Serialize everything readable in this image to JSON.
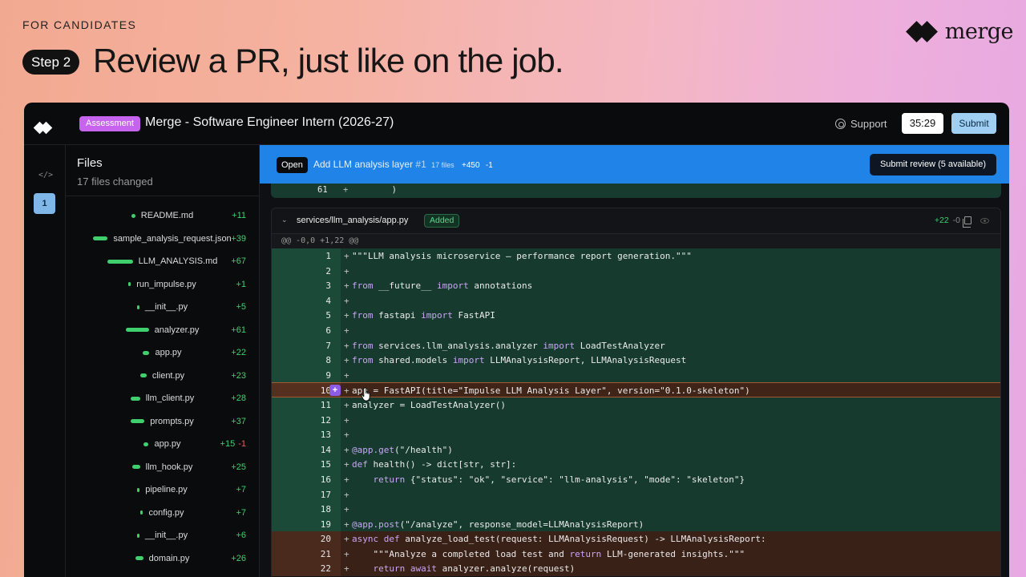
{
  "hero": {
    "eyebrow": "FOR CANDIDATES",
    "step_label": "Step 2",
    "title": "Review a PR, just like on the job."
  },
  "brand": {
    "name": "merge"
  },
  "header": {
    "badge": "Assessment",
    "title": "Merge - Software Engineer Intern (2026-27)",
    "support_label": "Support",
    "timer": "35:29",
    "submit_label": "Submit"
  },
  "rail": {
    "code_icon": "</>",
    "active_item": "1"
  },
  "files_panel": {
    "title": "Files",
    "subtitle": "17 files changed",
    "files": [
      {
        "name": "README.md",
        "added": "+11",
        "removed": "",
        "bar": 5
      },
      {
        "name": "sample_analysis_request.json",
        "added": "+39",
        "removed": "",
        "bar": 18
      },
      {
        "name": "LLM_ANALYSIS.md",
        "added": "+67",
        "removed": "",
        "bar": 32
      },
      {
        "name": "run_impulse.py",
        "added": "+1",
        "removed": "",
        "bar": 3
      },
      {
        "name": "__init__.py",
        "added": "+5",
        "removed": "",
        "bar": 3
      },
      {
        "name": "analyzer.py",
        "added": "+61",
        "removed": "",
        "bar": 29
      },
      {
        "name": "app.py",
        "added": "+22",
        "removed": "",
        "bar": 8
      },
      {
        "name": "client.py",
        "added": "+23",
        "removed": "",
        "bar": 8
      },
      {
        "name": "llm_client.py",
        "added": "+28",
        "removed": "",
        "bar": 12
      },
      {
        "name": "prompts.py",
        "added": "+37",
        "removed": "",
        "bar": 17
      },
      {
        "name": "app.py",
        "added": "+15",
        "removed": "-1",
        "bar": 6
      },
      {
        "name": "llm_hook.py",
        "added": "+25",
        "removed": "",
        "bar": 10
      },
      {
        "name": "pipeline.py",
        "added": "+7",
        "removed": "",
        "bar": 3
      },
      {
        "name": "config.py",
        "added": "+7",
        "removed": "",
        "bar": 3
      },
      {
        "name": "__init__.py",
        "added": "+6",
        "removed": "",
        "bar": 3
      },
      {
        "name": "domain.py",
        "added": "+26",
        "removed": "",
        "bar": 10
      }
    ]
  },
  "pr": {
    "status": "Open",
    "title": "Add LLM analysis layer",
    "number": "#1",
    "files_count": "17 files",
    "additions": "+450",
    "deletions": "-1",
    "review_button": "Submit review (5 available)"
  },
  "previous_hunk": {
    "line": "61",
    "sign": "+",
    "code": "        )"
  },
  "file_card": {
    "path": "services/llm_analysis/app.py",
    "status": "Added",
    "additions": "+22",
    "deletions": "-0",
    "hunk_header": "@@ -0,0 +1,22 @@",
    "add_comment_label": "+",
    "lines": [
      {
        "n": "1",
        "code": "\"\"\"LLM analysis microservice — performance report generation.\"\"\""
      },
      {
        "n": "2",
        "code": ""
      },
      {
        "n": "3",
        "code": "from __future__ import annotations"
      },
      {
        "n": "4",
        "code": ""
      },
      {
        "n": "5",
        "code": "from fastapi import FastAPI"
      },
      {
        "n": "6",
        "code": ""
      },
      {
        "n": "7",
        "code": "from services.llm_analysis.analyzer import LoadTestAnalyzer"
      },
      {
        "n": "8",
        "code": "from shared.models import LLMAnalysisReport, LLMAnalysisRequest"
      },
      {
        "n": "9",
        "code": ""
      },
      {
        "n": "10",
        "code": "app = FastAPI(title=\"Impulse LLM Analysis Layer\", version=\"0.1.0-skeleton\")"
      },
      {
        "n": "11",
        "code": "analyzer = LoadTestAnalyzer()"
      },
      {
        "n": "12",
        "code": ""
      },
      {
        "n": "13",
        "code": ""
      },
      {
        "n": "14",
        "code": "@app.get(\"/health\")"
      },
      {
        "n": "15",
        "code": "def health() -> dict[str, str]:"
      },
      {
        "n": "16",
        "code": "    return {\"status\": \"ok\", \"service\": \"llm-analysis\", \"mode\": \"skeleton\"}"
      },
      {
        "n": "17",
        "code": ""
      },
      {
        "n": "18",
        "code": ""
      },
      {
        "n": "19",
        "code": "@app.post(\"/analyze\", response_model=LLMAnalysisReport)"
      },
      {
        "n": "20",
        "code": "async def analyze_load_test(request: LLMAnalysisRequest) -> LLMAnalysisReport:"
      },
      {
        "n": "21",
        "code": "    \"\"\"Analyze a completed load test and return LLM-generated insights.\"\"\""
      },
      {
        "n": "22",
        "code": "    return await analyzer.analyze(request)"
      }
    ]
  },
  "colors": {
    "accent_blue": "#1f83e7",
    "assessment_badge": "#c764ef",
    "added_green": "#3fd072",
    "removed_red": "#ef5e5e"
  }
}
